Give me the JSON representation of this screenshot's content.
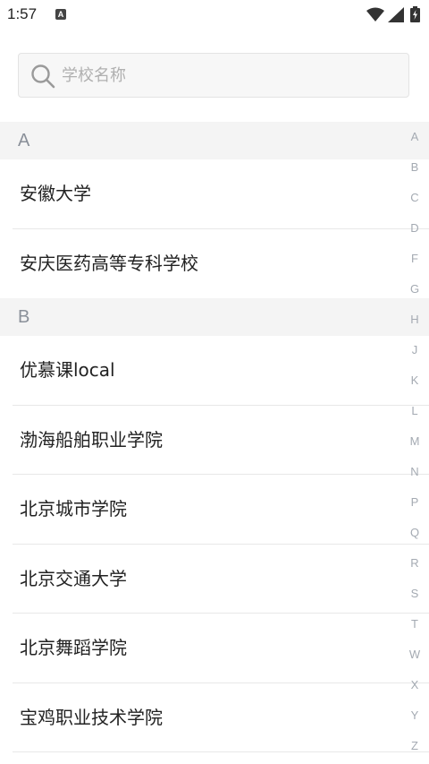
{
  "status_bar": {
    "time": "1:57",
    "notification": "A"
  },
  "search": {
    "placeholder": "学校名称"
  },
  "sections": [
    {
      "letter": "A",
      "items": [
        "安徽大学",
        "安庆医药高等专科学校"
      ]
    },
    {
      "letter": "B",
      "items": [
        "优慕课local",
        "渤海船舶职业学院",
        "北京城市学院",
        "北京交通大学",
        "北京舞蹈学院",
        "宝鸡职业技术学院"
      ]
    }
  ],
  "index_letters": [
    "A",
    "B",
    "C",
    "D",
    "F",
    "G",
    "H",
    "J",
    "K",
    "L",
    "M",
    "N",
    "P",
    "Q",
    "R",
    "S",
    "T",
    "W",
    "X",
    "Y",
    "Z"
  ]
}
